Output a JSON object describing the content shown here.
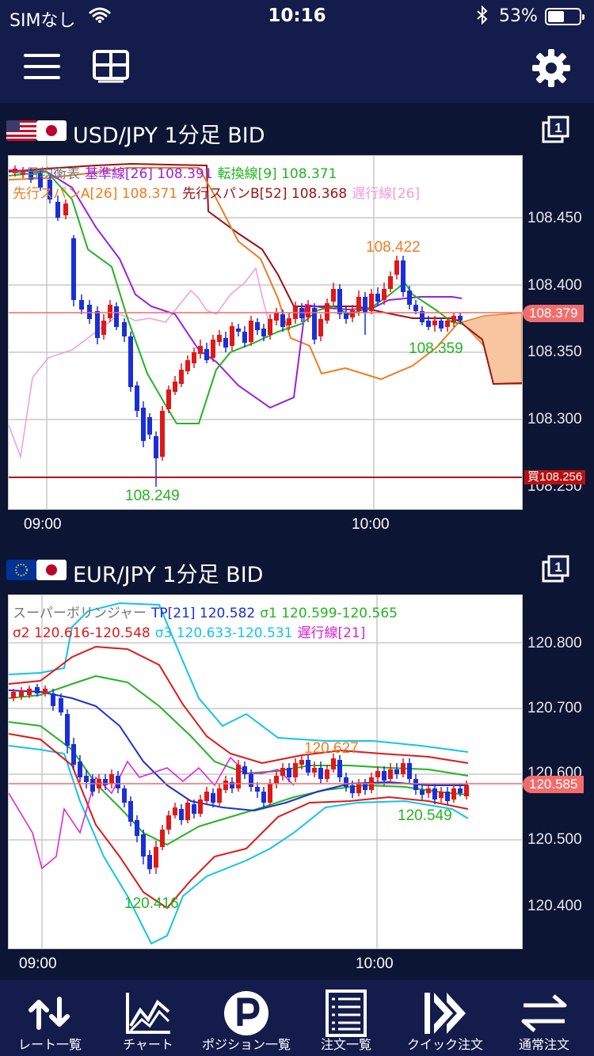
{
  "status_bar": {
    "carrier": "SIMなし",
    "time": "10:16",
    "battery_pct": "53%",
    "battery_level": 0.53
  },
  "toolbar": {
    "menu_icon": "hamburger-icon",
    "layout_icon": "layout-grid-icon",
    "settings_icon": "gear-icon"
  },
  "usdjpy": {
    "title": "USD/JPY 1分足 BID",
    "legend_row1": [
      {
        "text": "一目均衡表",
        "color": "#777777"
      },
      {
        "text": "基準線[26] 108.391",
        "color": "#9b1fe0"
      },
      {
        "text": "転換線[9] 108.371",
        "color": "#22b422"
      }
    ],
    "legend_row2": [
      {
        "text": "先行スパンA[26] 108.371",
        "color": "#f07c1d"
      },
      {
        "text": "先行スパンB[52] 108.368",
        "color": "#9c1212"
      },
      {
        "text": "遅行線[26]",
        "color": "#f59ad8"
      }
    ],
    "y_ticks": [
      "108.450",
      "108.400",
      "108.350",
      "108.300",
      "108.250"
    ],
    "x_ticks": [
      "09:00",
      "10:00"
    ],
    "current_price": "108.379",
    "buy_price": "買108.256",
    "high_label": "108.422",
    "low_label": "108.249",
    "last_label": "108.359"
  },
  "eurjpy": {
    "title": "EUR/JPY 1分足 BID",
    "legend_row1": [
      {
        "text": "スーパーボリンジャー",
        "color": "#777777"
      },
      {
        "text": "TP[21] 120.582",
        "color": "#1a2fd6"
      },
      {
        "text": "σ1 120.599-120.565",
        "color": "#22b422"
      }
    ],
    "legend_row2": [
      {
        "text": "σ2 120.616-120.548",
        "color": "#e01818"
      },
      {
        "text": "σ3 120.633-120.531",
        "color": "#12c4e8"
      },
      {
        "text": "遅行線[21]",
        "color": "#e01cd6"
      }
    ],
    "y_ticks": [
      "120.800",
      "120.700",
      "120.600",
      "120.500",
      "120.400"
    ],
    "x_ticks": [
      "09:00",
      "10:00"
    ],
    "current_price": "120.585",
    "high_label": "120.627",
    "low_label": "120.416",
    "last_label": "120.549"
  },
  "tabs": [
    {
      "label": "レート一覧",
      "icon": "up-down-arrows-icon"
    },
    {
      "label": "チャート",
      "icon": "chart-line-icon"
    },
    {
      "label": "ポジション一覧",
      "icon": "position-p-icon"
    },
    {
      "label": "注文一覧",
      "icon": "order-list-icon"
    },
    {
      "label": "クイック注文",
      "icon": "quick-order-icon"
    },
    {
      "label": "通常注文",
      "icon": "exchange-icon"
    }
  ],
  "colors": {
    "background": "#0d1535",
    "header": "#131c4b",
    "bull": "#e01818",
    "bear": "#1a2fd6",
    "price_line": "#f26c6c"
  }
}
